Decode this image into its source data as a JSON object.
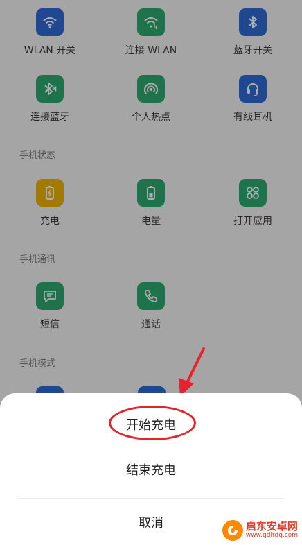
{
  "colors": {
    "blue": "#2f6bd6",
    "green": "#2faa71",
    "yellow": "#f0b400",
    "overlay": "rgba(0,0,0,0.32)",
    "annotation_red": "#e4242a"
  },
  "connectivity": [
    {
      "label": "WLAN 开关",
      "icon": "wifi-icon",
      "color": "blue"
    },
    {
      "label": "连接 WLAN",
      "icon": "wifi-connect-icon",
      "color": "green"
    },
    {
      "label": "蓝牙开关",
      "icon": "bluetooth-icon",
      "color": "blue"
    },
    {
      "label": "连接蓝牙",
      "icon": "bluetooth-connect-icon",
      "color": "green"
    },
    {
      "label": "个人热点",
      "icon": "hotspot-icon",
      "color": "green"
    },
    {
      "label": "有线耳机",
      "icon": "headset-icon",
      "color": "blue"
    }
  ],
  "phone_status": {
    "title": "手机状态",
    "items": [
      {
        "label": "充电",
        "icon": "charging-battery-icon",
        "color": "yellow"
      },
      {
        "label": "电量",
        "icon": "battery-icon",
        "color": "green"
      },
      {
        "label": "打开应用",
        "icon": "apps-grid-icon",
        "color": "green"
      }
    ]
  },
  "phone_comm": {
    "title": "手机通讯",
    "items": [
      {
        "label": "短信",
        "icon": "message-icon",
        "color": "green"
      },
      {
        "label": "通话",
        "icon": "phone-icon",
        "color": "green"
      }
    ]
  },
  "phone_mode": {
    "title": "手机模式"
  },
  "sheet": {
    "start_label": "开始充电",
    "end_label": "结束充电",
    "cancel_label": "取消"
  },
  "watermark": {
    "title": "启东安卓网",
    "url": "www.qdltdq.com"
  }
}
